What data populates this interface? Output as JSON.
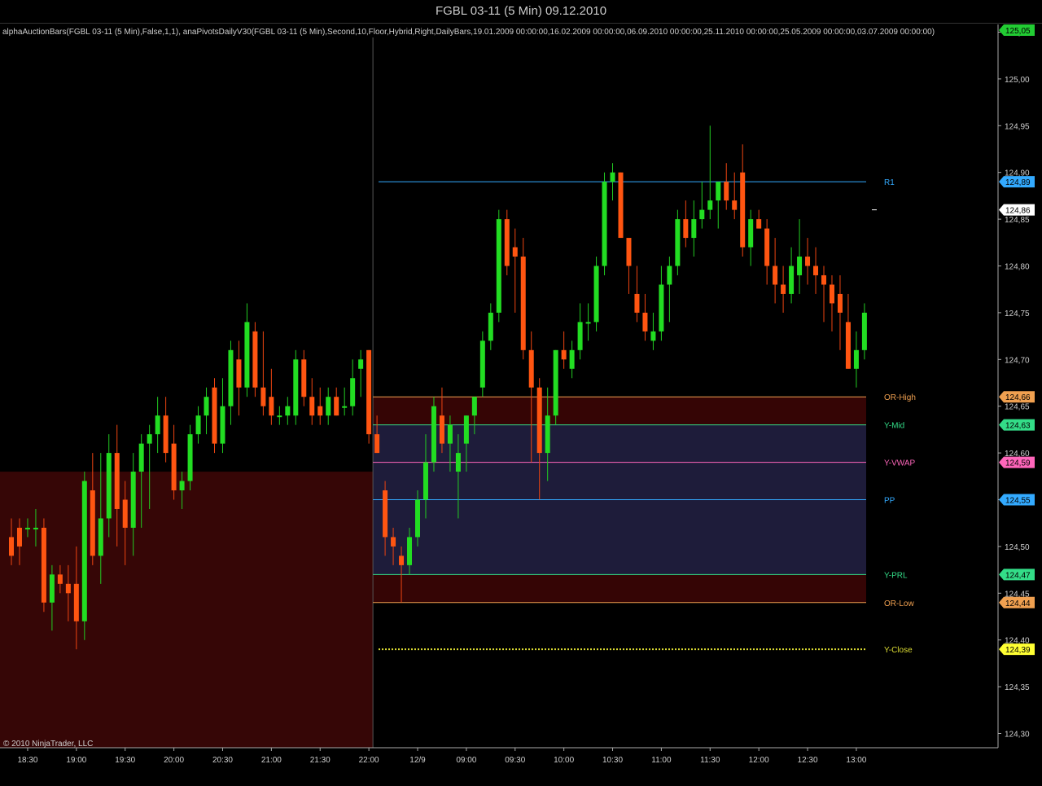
{
  "window": {
    "title": "FGBL 03-11 (5 Min)  09.12.2010"
  },
  "indicator_caption": "alphaAuctionBars(FGBL 03-11 (5 Min),False,1,1), anaPivotsDailyV30(FGBL 03-11 (5 Min),Second,10,Floor,Hybrid,Right,DailyBars,19.01.2009 00:00:00,16.02.2009 00:00:00,06.09.2010 00:00:00,25.11.2010 00:00:00,25.05.2009 00:00:00,03.07.2009 00:00:00)",
  "copyright": "© 2010 NinjaTrader, LLC",
  "colors": {
    "background": "#000000",
    "up_bar": "#22dd22",
    "down_bar": "#ff5511",
    "up_wick": "#22cc22",
    "down_wick": "#ee4411",
    "prev_session_zone": "#360606",
    "value_area": "#1e1c3a",
    "opening_range": "#350505",
    "axis": "#aaaaaa"
  },
  "chart_data": {
    "type": "candlestick",
    "symbol": "FGBL 03-11",
    "interval": "5 Min",
    "date": "09.12.2010",
    "ylim": [
      124.275,
      125.075
    ],
    "y_ticks": [
      "125,05",
      "125,00",
      "124,95",
      "124,90",
      "124,85",
      "124,80",
      "124,75",
      "124,70",
      "124,65",
      "124,60",
      "124,55",
      "124,50",
      "124,45",
      "124,40",
      "124,35",
      "124,30"
    ],
    "x_ticks": [
      {
        "label": "18:30",
        "bar": 2
      },
      {
        "label": "19:00",
        "bar": 8
      },
      {
        "label": "19:30",
        "bar": 14
      },
      {
        "label": "20:00",
        "bar": 20
      },
      {
        "label": "20:30",
        "bar": 26
      },
      {
        "label": "21:00",
        "bar": 32
      },
      {
        "label": "21:30",
        "bar": 38
      },
      {
        "label": "22:00",
        "bar": 44
      },
      {
        "label": "12/9",
        "bar": 50
      },
      {
        "label": "09:00",
        "bar": 56
      },
      {
        "label": "09:30",
        "bar": 62
      },
      {
        "label": "10:00",
        "bar": 68
      },
      {
        "label": "10:30",
        "bar": 74
      },
      {
        "label": "11:00",
        "bar": 80
      },
      {
        "label": "11:30",
        "bar": 86
      },
      {
        "label": "12:00",
        "bar": 92
      },
      {
        "label": "12:30",
        "bar": 98
      },
      {
        "label": "13:00",
        "bar": 104
      }
    ],
    "session_break_bar": 44.5,
    "bars": [
      {
        "o": 124.51,
        "h": 124.53,
        "l": 124.48,
        "c": 124.49
      },
      {
        "o": 124.52,
        "h": 124.53,
        "l": 124.48,
        "c": 124.5
      },
      {
        "o": 124.52,
        "h": 124.53,
        "l": 124.51,
        "c": 124.52
      },
      {
        "o": 124.52,
        "h": 124.54,
        "l": 124.5,
        "c": 124.52
      },
      {
        "o": 124.52,
        "h": 124.53,
        "l": 124.43,
        "c": 124.44
      },
      {
        "o": 124.44,
        "h": 124.48,
        "l": 124.41,
        "c": 124.47
      },
      {
        "o": 124.47,
        "h": 124.48,
        "l": 124.45,
        "c": 124.46
      },
      {
        "o": 124.46,
        "h": 124.48,
        "l": 124.42,
        "c": 124.45
      },
      {
        "o": 124.46,
        "h": 124.5,
        "l": 124.39,
        "c": 124.42
      },
      {
        "o": 124.42,
        "h": 124.58,
        "l": 124.4,
        "c": 124.57
      },
      {
        "o": 124.56,
        "h": 124.6,
        "l": 124.48,
        "c": 124.49
      },
      {
        "o": 124.49,
        "h": 124.6,
        "l": 124.46,
        "c": 124.53
      },
      {
        "o": 124.53,
        "h": 124.62,
        "l": 124.51,
        "c": 124.6
      },
      {
        "o": 124.6,
        "h": 124.63,
        "l": 124.5,
        "c": 124.54
      },
      {
        "o": 124.55,
        "h": 124.57,
        "l": 124.48,
        "c": 124.52
      },
      {
        "o": 124.52,
        "h": 124.6,
        "l": 124.49,
        "c": 124.58
      },
      {
        "o": 124.58,
        "h": 124.62,
        "l": 124.52,
        "c": 124.61
      },
      {
        "o": 124.61,
        "h": 124.63,
        "l": 124.54,
        "c": 124.62
      },
      {
        "o": 124.62,
        "h": 124.66,
        "l": 124.6,
        "c": 124.64
      },
      {
        "o": 124.64,
        "h": 124.66,
        "l": 124.59,
        "c": 124.6
      },
      {
        "o": 124.61,
        "h": 124.63,
        "l": 124.55,
        "c": 124.56
      },
      {
        "o": 124.56,
        "h": 124.58,
        "l": 124.54,
        "c": 124.57
      },
      {
        "o": 124.57,
        "h": 124.63,
        "l": 124.56,
        "c": 124.62
      },
      {
        "o": 124.62,
        "h": 124.65,
        "l": 124.61,
        "c": 124.64
      },
      {
        "o": 124.64,
        "h": 124.67,
        "l": 124.62,
        "c": 124.66
      },
      {
        "o": 124.67,
        "h": 124.68,
        "l": 124.6,
        "c": 124.61
      },
      {
        "o": 124.61,
        "h": 124.68,
        "l": 124.6,
        "c": 124.65
      },
      {
        "o": 124.65,
        "h": 124.72,
        "l": 124.63,
        "c": 124.71
      },
      {
        "o": 124.7,
        "h": 124.72,
        "l": 124.64,
        "c": 124.67
      },
      {
        "o": 124.67,
        "h": 124.76,
        "l": 124.66,
        "c": 124.74
      },
      {
        "o": 124.73,
        "h": 124.74,
        "l": 124.66,
        "c": 124.67
      },
      {
        "o": 124.67,
        "h": 124.73,
        "l": 124.64,
        "c": 124.65
      },
      {
        "o": 124.66,
        "h": 124.69,
        "l": 124.63,
        "c": 124.64
      },
      {
        "o": 124.64,
        "h": 124.65,
        "l": 124.63,
        "c": 124.64
      },
      {
        "o": 124.64,
        "h": 124.66,
        "l": 124.63,
        "c": 124.65
      },
      {
        "o": 124.64,
        "h": 124.71,
        "l": 124.63,
        "c": 124.7
      },
      {
        "o": 124.7,
        "h": 124.71,
        "l": 124.65,
        "c": 124.66
      },
      {
        "o": 124.66,
        "h": 124.68,
        "l": 124.63,
        "c": 124.64
      },
      {
        "o": 124.65,
        "h": 124.67,
        "l": 124.63,
        "c": 124.64
      },
      {
        "o": 124.64,
        "h": 124.67,
        "l": 124.63,
        "c": 124.66
      },
      {
        "o": 124.66,
        "h": 124.67,
        "l": 124.64,
        "c": 124.64
      },
      {
        "o": 124.65,
        "h": 124.67,
        "l": 124.64,
        "c": 124.65
      },
      {
        "o": 124.65,
        "h": 124.7,
        "l": 124.64,
        "c": 124.68
      },
      {
        "o": 124.69,
        "h": 124.71,
        "l": 124.66,
        "c": 124.7
      },
      {
        "o": 124.71,
        "h": 124.71,
        "l": 124.61,
        "c": 124.62
      },
      {
        "o": 124.62,
        "h": 124.64,
        "l": 124.6,
        "c": 124.6
      },
      {
        "o": 124.56,
        "h": 124.57,
        "l": 124.49,
        "c": 124.51
      },
      {
        "o": 124.51,
        "h": 124.52,
        "l": 124.48,
        "c": 124.5
      },
      {
        "o": 124.49,
        "h": 124.5,
        "l": 124.44,
        "c": 124.48
      },
      {
        "o": 124.48,
        "h": 124.52,
        "l": 124.47,
        "c": 124.51
      },
      {
        "o": 124.51,
        "h": 124.56,
        "l": 124.5,
        "c": 124.55
      },
      {
        "o": 124.55,
        "h": 124.62,
        "l": 124.53,
        "c": 124.59
      },
      {
        "o": 124.59,
        "h": 124.66,
        "l": 124.58,
        "c": 124.65
      },
      {
        "o": 124.64,
        "h": 124.67,
        "l": 124.6,
        "c": 124.61
      },
      {
        "o": 124.61,
        "h": 124.64,
        "l": 124.58,
        "c": 124.63
      },
      {
        "o": 124.58,
        "h": 124.62,
        "l": 124.53,
        "c": 124.6
      },
      {
        "o": 124.61,
        "h": 124.64,
        "l": 124.58,
        "c": 124.64
      },
      {
        "o": 124.64,
        "h": 124.66,
        "l": 124.62,
        "c": 124.66
      },
      {
        "o": 124.67,
        "h": 124.73,
        "l": 124.66,
        "c": 124.72
      },
      {
        "o": 124.72,
        "h": 124.76,
        "l": 124.71,
        "c": 124.75
      },
      {
        "o": 124.75,
        "h": 124.86,
        "l": 124.74,
        "c": 124.85
      },
      {
        "o": 124.85,
        "h": 124.86,
        "l": 124.79,
        "c": 124.8
      },
      {
        "o": 124.82,
        "h": 124.84,
        "l": 124.75,
        "c": 124.81
      },
      {
        "o": 124.81,
        "h": 124.83,
        "l": 124.7,
        "c": 124.71
      },
      {
        "o": 124.71,
        "h": 124.73,
        "l": 124.59,
        "c": 124.67
      },
      {
        "o": 124.67,
        "h": 124.68,
        "l": 124.55,
        "c": 124.6
      },
      {
        "o": 124.6,
        "h": 124.67,
        "l": 124.57,
        "c": 124.64
      },
      {
        "o": 124.64,
        "h": 124.71,
        "l": 124.63,
        "c": 124.71
      },
      {
        "o": 124.71,
        "h": 124.73,
        "l": 124.69,
        "c": 124.7
      },
      {
        "o": 124.69,
        "h": 124.72,
        "l": 124.68,
        "c": 124.71
      },
      {
        "o": 124.71,
        "h": 124.76,
        "l": 124.7,
        "c": 124.74
      },
      {
        "o": 124.74,
        "h": 124.76,
        "l": 124.72,
        "c": 124.74
      },
      {
        "o": 124.74,
        "h": 124.81,
        "l": 124.73,
        "c": 124.8
      },
      {
        "o": 124.8,
        "h": 124.9,
        "l": 124.79,
        "c": 124.89
      },
      {
        "o": 124.89,
        "h": 124.91,
        "l": 124.87,
        "c": 124.9
      },
      {
        "o": 124.9,
        "h": 124.9,
        "l": 124.83,
        "c": 124.83
      },
      {
        "o": 124.83,
        "h": 124.82,
        "l": 124.77,
        "c": 124.8
      },
      {
        "o": 124.77,
        "h": 124.8,
        "l": 124.74,
        "c": 124.75
      },
      {
        "o": 124.75,
        "h": 124.77,
        "l": 124.72,
        "c": 124.73
      },
      {
        "o": 124.72,
        "h": 124.75,
        "l": 124.71,
        "c": 124.73
      },
      {
        "o": 124.73,
        "h": 124.8,
        "l": 124.72,
        "c": 124.78
      },
      {
        "o": 124.78,
        "h": 124.81,
        "l": 124.74,
        "c": 124.8
      },
      {
        "o": 124.8,
        "h": 124.86,
        "l": 124.79,
        "c": 124.85
      },
      {
        "o": 124.85,
        "h": 124.87,
        "l": 124.82,
        "c": 124.83
      },
      {
        "o": 124.83,
        "h": 124.87,
        "l": 124.81,
        "c": 124.85
      },
      {
        "o": 124.85,
        "h": 124.89,
        "l": 124.84,
        "c": 124.86
      },
      {
        "o": 124.86,
        "h": 124.95,
        "l": 124.85,
        "c": 124.87
      },
      {
        "o": 124.87,
        "h": 124.89,
        "l": 124.84,
        "c": 124.89
      },
      {
        "o": 124.89,
        "h": 124.91,
        "l": 124.86,
        "c": 124.87
      },
      {
        "o": 124.87,
        "h": 124.9,
        "l": 124.85,
        "c": 124.86
      },
      {
        "o": 124.9,
        "h": 124.93,
        "l": 124.81,
        "c": 124.82
      },
      {
        "o": 124.82,
        "h": 124.86,
        "l": 124.8,
        "c": 124.85
      },
      {
        "o": 124.85,
        "h": 124.86,
        "l": 124.84,
        "c": 124.84
      },
      {
        "o": 124.84,
        "h": 124.85,
        "l": 124.78,
        "c": 124.8
      },
      {
        "o": 124.8,
        "h": 124.83,
        "l": 124.76,
        "c": 124.78
      },
      {
        "o": 124.78,
        "h": 124.8,
        "l": 124.75,
        "c": 124.77
      },
      {
        "o": 124.77,
        "h": 124.82,
        "l": 124.76,
        "c": 124.8
      },
      {
        "o": 124.79,
        "h": 124.85,
        "l": 124.77,
        "c": 124.81
      },
      {
        "o": 124.81,
        "h": 124.83,
        "l": 124.78,
        "c": 124.8
      },
      {
        "o": 124.8,
        "h": 124.82,
        "l": 124.77,
        "c": 124.79
      },
      {
        "o": 124.79,
        "h": 124.8,
        "l": 124.74,
        "c": 124.78
      },
      {
        "o": 124.78,
        "h": 124.79,
        "l": 124.73,
        "c": 124.76
      },
      {
        "o": 124.77,
        "h": 124.79,
        "l": 124.71,
        "c": 124.75
      },
      {
        "o": 124.74,
        "h": 124.77,
        "l": 124.69,
        "c": 124.69
      },
      {
        "o": 124.69,
        "h": 124.73,
        "l": 124.67,
        "c": 124.71
      },
      {
        "o": 124.71,
        "h": 124.76,
        "l": 124.7,
        "c": 124.75
      }
    ],
    "levels": [
      {
        "name": "R1",
        "value": 124.89,
        "price_label": "124,89",
        "color": "#33aaff",
        "tag_color": "#33aaff",
        "dotted": false
      },
      {
        "name": "OR-High",
        "value": 124.66,
        "price_label": "124,66",
        "color": "#f0a050",
        "tag_color": "#f0a050",
        "dotted": false
      },
      {
        "name": "Y-Mid",
        "value": 124.63,
        "price_label": "124,63",
        "color": "#33dd88",
        "tag_color": "#33dd88",
        "dotted": false
      },
      {
        "name": "Y-VWAP",
        "value": 124.59,
        "price_label": "124,59",
        "color": "#ff66bb",
        "tag_color": "#ff66bb",
        "dotted": false
      },
      {
        "name": "PP",
        "value": 124.55,
        "price_label": "124,55",
        "color": "#33aaff",
        "tag_color": "#33aaff",
        "dotted": false
      },
      {
        "name": "Y-PRL",
        "value": 124.47,
        "price_label": "124,47",
        "color": "#33dd88",
        "tag_color": "#33dd88",
        "dotted": false
      },
      {
        "name": "OR-Low",
        "value": 124.44,
        "price_label": "124,44",
        "color": "#f0a050",
        "tag_color": "#f0a050",
        "dotted": false
      },
      {
        "name": "Y-Close",
        "value": 124.39,
        "price_label": "124,39",
        "color": "#dddd33",
        "tag_color": "#ffff33",
        "dotted": true
      }
    ],
    "last_price": {
      "value": 124.86,
      "label": "124,86"
    },
    "top_tag": {
      "value": 125.05,
      "label": "125,05",
      "color": "#22cc33"
    },
    "prev_session_zone": {
      "from_bar": 0,
      "to_bar": 44.5,
      "top": 124.58,
      "bottom": 124.275
    },
    "value_area": {
      "top": 124.63,
      "bottom": 124.47
    },
    "opening_range_zone": {
      "top": 124.66,
      "bottom": 124.44
    }
  }
}
